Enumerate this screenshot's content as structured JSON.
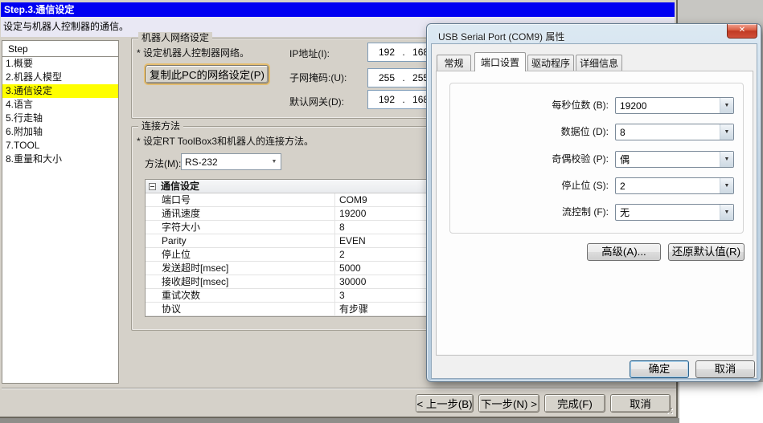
{
  "colors": {
    "titlebar_blue": "#0000f2",
    "highlight_yellow": "#ffff00",
    "close_button_red": "#d0503a",
    "focus_gold": "#e4bd6f",
    "focus_blue": "#2c628b"
  },
  "wizard": {
    "title": "Step.3.通信设定",
    "subtitle": "设定与机器人控制器的通信。",
    "sidebar": {
      "header": "Step",
      "items": [
        "1.概要",
        "2.机器人模型",
        "3.通信设定",
        "4.语言",
        "5.行走轴",
        "6.附加轴",
        "7.TOOL",
        "8.重量和大小"
      ],
      "active_item": "3.通信设定"
    },
    "network_group": {
      "title": "机器人网络设定",
      "note": "* 设定机器人控制器网络。",
      "copy_button": "复制此PC的网络设定(P)",
      "fields": [
        {
          "label": "IP地址(I):",
          "value": "192 . 168"
        },
        {
          "label": "子网掩码:(U):",
          "value": "255 . 255"
        },
        {
          "label": "默认网关(D):",
          "value": "192 . 168"
        }
      ]
    },
    "connection_group": {
      "title": "连接方法",
      "note": "* 设定RT ToolBox3和机器人的连接方法。",
      "method_label": "方法(M):",
      "method_value": "RS-232",
      "table": {
        "header": "通信设定",
        "rows": [
          {
            "label": "端口号",
            "value": "COM9"
          },
          {
            "label": "通讯速度",
            "value": "19200"
          },
          {
            "label": "字符大小",
            "value": "8"
          },
          {
            "label": "Parity",
            "value": "EVEN"
          },
          {
            "label": "停止位",
            "value": "2"
          },
          {
            "label": "发送超时[msec]",
            "value": "5000"
          },
          {
            "label": "接收超时[msec]",
            "value": "30000"
          },
          {
            "label": "重试次数",
            "value": "3"
          },
          {
            "label": "协议",
            "value": "有步骤"
          }
        ]
      }
    },
    "footer": {
      "back": "< 上一步(B)",
      "next": "下一步(N) >",
      "finish": "完成(F)",
      "cancel": "取消"
    }
  },
  "dialog": {
    "title": "USB Serial Port (COM9) 属性",
    "close_glyph": "✕",
    "tabs": [
      "常规",
      "端口设置",
      "驱动程序",
      "详细信息"
    ],
    "active_tab": "端口设置",
    "fields": [
      {
        "label": "每秒位数 (B):",
        "value": "19200"
      },
      {
        "label": "数据位 (D):",
        "value": "8"
      },
      {
        "label": "奇偶校验 (P):",
        "value": "偶"
      },
      {
        "label": "停止位 (S):",
        "value": "2"
      },
      {
        "label": "流控制 (F):",
        "value": "无"
      }
    ],
    "advanced_button": "高级(A)...",
    "restore_button": "还原默认值(R)",
    "ok_button": "确定",
    "cancel_button": "取消"
  }
}
